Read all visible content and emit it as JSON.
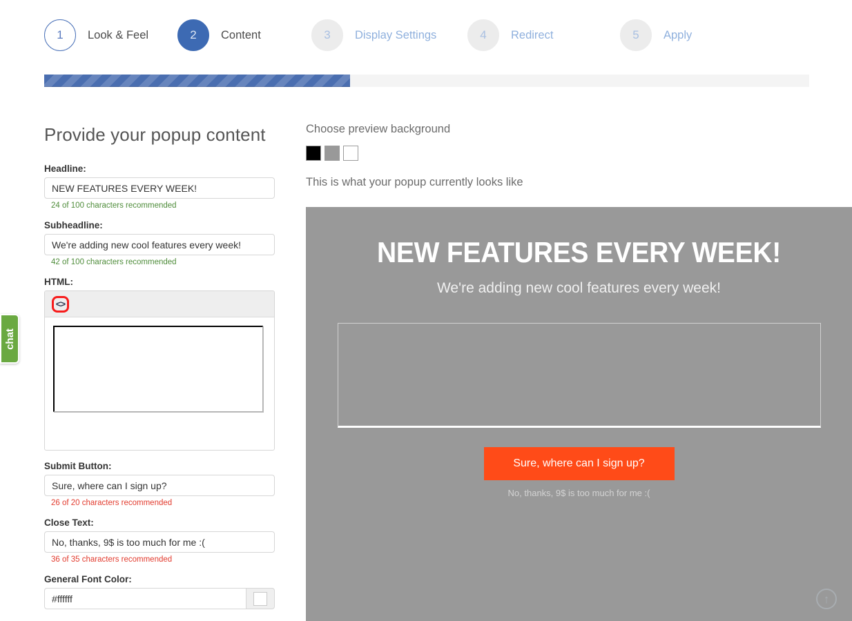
{
  "stepper": {
    "steps": [
      {
        "number": "1",
        "label": "Look & Feel",
        "state": "done"
      },
      {
        "number": "2",
        "label": "Content",
        "state": "active"
      },
      {
        "number": "3",
        "label": "Display Settings",
        "state": "upcoming"
      },
      {
        "number": "4",
        "label": "Redirect",
        "state": "upcoming"
      },
      {
        "number": "5",
        "label": "Apply",
        "state": "upcoming"
      }
    ]
  },
  "progress": {
    "percent": 40,
    "fill_color": "#4a6eb0",
    "track_color": "#f4f4f4"
  },
  "form": {
    "title": "Provide your popup content",
    "headline": {
      "label": "Headline:",
      "value": "NEW FEATURES EVERY WEEK!",
      "hint": "24 of 100 characters recommended",
      "hint_state": "ok"
    },
    "subheadline": {
      "label": "Subheadline:",
      "value": "We're adding new cool features every week!",
      "hint": "42 of 100 characters recommended",
      "hint_state": "ok"
    },
    "html": {
      "label": "HTML:",
      "toolbar_icon": "code-icon",
      "value": ""
    },
    "submit_button": {
      "label": "Submit Button:",
      "value": "Sure, where can I sign up?",
      "hint": "26 of 20 characters recommended",
      "hint_state": "bad"
    },
    "close_text": {
      "label": "Close Text:",
      "value": "No, thanks, 9$ is too much for me :(",
      "hint": "36 of 35 characters recommended",
      "hint_state": "bad"
    },
    "general_font_color": {
      "label": "General Font Color:",
      "value": "#ffffff",
      "swatch_color": "#ffffff"
    }
  },
  "preview": {
    "choose_background_label": "Choose preview background",
    "backgrounds": [
      {
        "name": "black",
        "color": "#000000"
      },
      {
        "name": "gray",
        "color": "#999999"
      },
      {
        "name": "white",
        "color": "#ffffff"
      }
    ],
    "selected_background": "#999999",
    "looks_like_label": "This is what your popup currently looks like",
    "popup": {
      "headline": "NEW FEATURES EVERY WEEK!",
      "subheadline": "We're adding new cool features every week!",
      "input_value": "",
      "submit_label": "Sure, where can I sign up?",
      "close_label": "No, thanks, 9$ is too much for me :(",
      "submit_color": "#ff4b18",
      "font_color": "#ffffff"
    }
  },
  "chat_widget": {
    "label": "chat",
    "color": "#6aa941"
  },
  "scroll_top": {
    "icon": "arrow-up-icon",
    "glyph": "↑"
  }
}
